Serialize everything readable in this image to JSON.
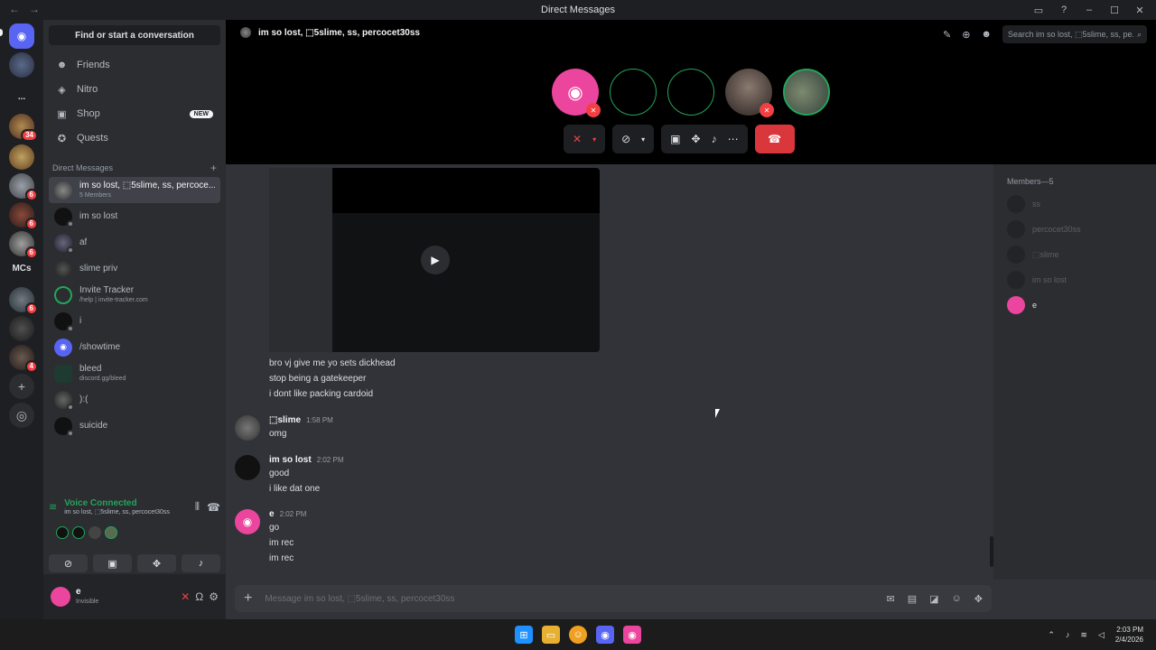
{
  "window": {
    "title": "Direct Messages",
    "back": "←",
    "forward": "→",
    "inbox_icon": "inbox-icon",
    "help": "?",
    "minimize": "–",
    "maximize": "☐",
    "close": "✕"
  },
  "servers": {
    "badges": [
      "34",
      "6",
      "6",
      "6",
      "6",
      "4"
    ],
    "folder_label": "MCs",
    "more": "..."
  },
  "sidebar": {
    "search_label": "Find or start a conversation",
    "nav": [
      {
        "label": "Friends",
        "icon": "friends-icon"
      },
      {
        "label": "Nitro",
        "icon": "nitro-icon"
      },
      {
        "label": "Shop",
        "icon": "shop-icon",
        "badge": "NEW"
      },
      {
        "label": "Quests",
        "icon": "quests-icon"
      }
    ],
    "dm_header": "Direct Messages",
    "dm_add": "+",
    "dms": [
      {
        "name": "im so lost, ⬚5slime, ss, percoce...",
        "sub": "5 Members"
      },
      {
        "name": "im so lost",
        "sub": ""
      },
      {
        "name": "af",
        "sub": ""
      },
      {
        "name": "slime priv",
        "sub": ""
      },
      {
        "name": "Invite Tracker",
        "sub": "/help | invite-tracker.com"
      },
      {
        "name": "i",
        "sub": ""
      },
      {
        "name": "/showtime",
        "sub": ""
      },
      {
        "name": "bleed",
        "sub": "discord.gg/bleed"
      },
      {
        "name": "):(",
        "sub": ""
      },
      {
        "name": "suicide",
        "sub": ""
      }
    ]
  },
  "voice": {
    "title": "Voice Connected",
    "channel": "im so lost, ⬚5slime, ss, percocet30ss"
  },
  "user": {
    "name": "e",
    "status": "Invisible"
  },
  "call": {
    "channel_title": "im so lost, ⬚5slime, ss, percocet30ss",
    "search_placeholder": "Search im so lost, ⬚5slime, ss, pe..."
  },
  "messages": {
    "lines_top": [
      "bro vj give me yo sets dickhead",
      "stop being a gatekeeper",
      "i dont like packing cardoid"
    ],
    "groups": [
      {
        "author": "⬚slime",
        "time": "1:58 PM",
        "lines": [
          "omg"
        ]
      },
      {
        "author": "im so lost",
        "time": "2:02 PM",
        "lines": [
          "good",
          "i like dat one"
        ]
      },
      {
        "author": "e",
        "time": "2:02 PM",
        "lines": [
          "go",
          "im rec",
          "im rec"
        ]
      }
    ]
  },
  "members": {
    "header": "Members—5",
    "list": [
      {
        "name": "ss",
        "online": false
      },
      {
        "name": "percocet30ss",
        "online": false
      },
      {
        "name": "⬚slime",
        "online": false
      },
      {
        "name": "im so lost",
        "online": false
      },
      {
        "name": "e",
        "online": true
      }
    ]
  },
  "composer": {
    "placeholder": "Message im so lost, ⬚5slime, ss, percocet30ss"
  },
  "taskbar": {
    "time": "2:03 PM",
    "date": "2/4/2026"
  }
}
